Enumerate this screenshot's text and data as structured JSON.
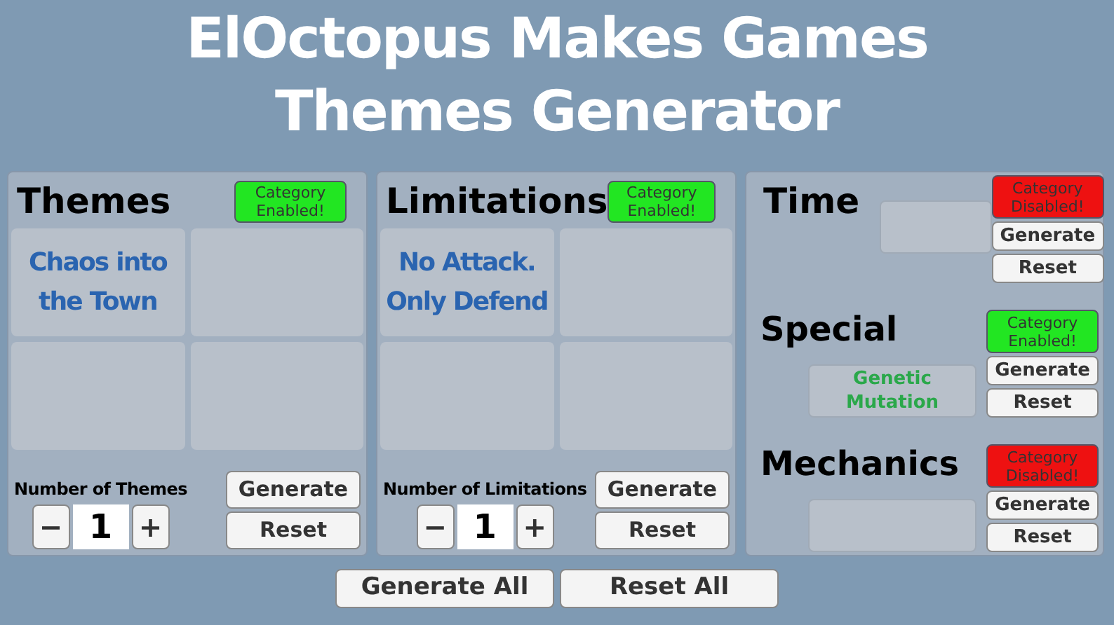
{
  "title": [
    "ElOctopus Makes Games",
    "Themes Generator"
  ],
  "panels": [
    {
      "title": "Themes",
      "toggle": {
        "label": "Category Enabled!",
        "enabled": true
      },
      "cells": [
        {
          "text": "Chaos into the Town",
          "color": "#2a64b0"
        },
        {},
        {},
        {}
      ],
      "count": {
        "label": "Number of Themes",
        "minus": "−",
        "value": "1",
        "plus": "+"
      },
      "generate": "Generate",
      "reset": "Reset"
    },
    {
      "title": "Limitations",
      "toggle": {
        "label": "Category Enabled!",
        "enabled": true
      },
      "cells": [
        {
          "text": "No Attack. Only Defend",
          "color": "#2a64b0"
        },
        {},
        {},
        {}
      ],
      "count": {
        "label": "Number of Limitations",
        "minus": "−",
        "value": "1",
        "plus": "+"
      },
      "generate": "Generate",
      "reset": "Reset"
    }
  ],
  "extras": [
    {
      "kind": "inline",
      "title": "Time",
      "toggle": {
        "label": "Category Disabled!",
        "enabled": false
      },
      "generate": "Generate",
      "reset": "Reset"
    },
    {
      "kind": "below",
      "title": "Special",
      "result": {
        "text": "Genetic Mutation",
        "color": "#2aa84a"
      },
      "toggle": {
        "label": "Category Enabled!",
        "enabled": true
      },
      "generate": "Generate",
      "reset": "Reset"
    },
    {
      "kind": "below",
      "title": "Mechanics",
      "toggle": {
        "label": "Category Disabled!",
        "enabled": false
      },
      "generate": "Generate",
      "reset": "Reset"
    }
  ],
  "footer": [
    "Generate All",
    "Reset All"
  ]
}
